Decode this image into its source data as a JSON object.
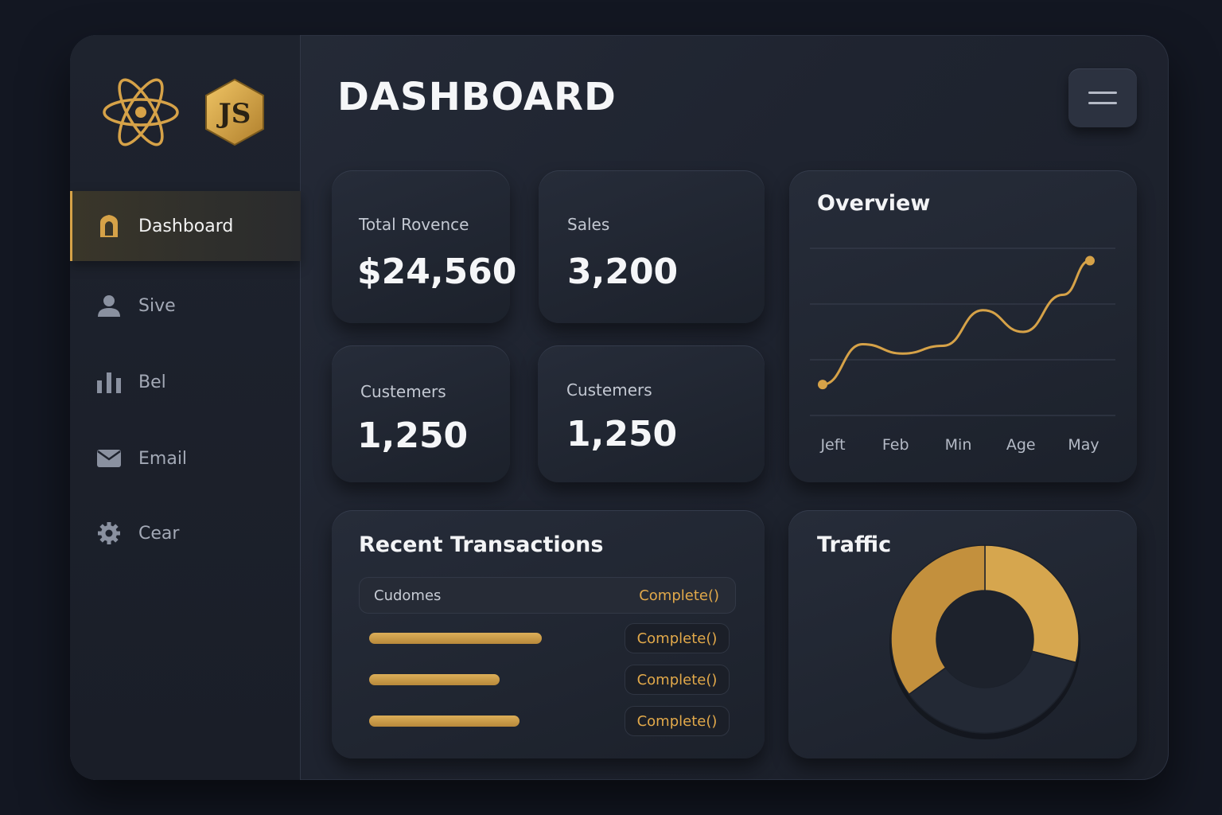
{
  "app": {
    "title": "DASHBOARD",
    "logos": [
      "react-logo",
      "js-logo"
    ],
    "js_logo_text": "JS"
  },
  "colors": {
    "accent": "#d6a248",
    "background": "#131722",
    "panel": "#1e232e",
    "text": "#e9ecf2",
    "muted": "#a3a9b6"
  },
  "sidebar": {
    "items": [
      {
        "label": "Dashboard",
        "icon": "home-icon",
        "active": true
      },
      {
        "label": "Sive",
        "icon": "user-icon",
        "active": false
      },
      {
        "label": "Bel",
        "icon": "bar-chart-icon",
        "active": false
      },
      {
        "label": "Email",
        "icon": "mail-icon",
        "active": false
      },
      {
        "label": "Cear",
        "icon": "gear-icon",
        "active": false
      }
    ]
  },
  "header": {
    "menu_icon": "hamburger-icon"
  },
  "stats": [
    {
      "label": "Total Rovence",
      "value": "$24,560"
    },
    {
      "label": "Sales",
      "value": "3,200"
    },
    {
      "label": "Custemers",
      "value": "1,250"
    },
    {
      "label": "Custemers",
      "value": "1,250"
    }
  ],
  "overview": {
    "title": "Overview",
    "chart_data": {
      "type": "line",
      "categories": [
        "Jeft",
        "Feb",
        "Min",
        "Age",
        "May"
      ],
      "x": [
        0,
        0.6,
        1.2,
        1.8,
        2.4,
        3.0,
        3.6,
        4.0
      ],
      "values": [
        2.0,
        4.6,
        4.0,
        4.5,
        6.8,
        5.4,
        7.8,
        10.0
      ],
      "ylim": [
        0,
        10.8
      ],
      "grid": true,
      "gridlines": 4,
      "color": "#d6a248"
    }
  },
  "transactions": {
    "title": "Recent Transactions",
    "header": {
      "column": "Cudomes",
      "status": "Complete()"
    },
    "rows": [
      {
        "progress": 0.86,
        "status": "Complete()"
      },
      {
        "progress": 0.65,
        "status": "Complete()"
      },
      {
        "progress": 0.75,
        "status": "Complete()"
      }
    ]
  },
  "traffic": {
    "title": "Traffic",
    "chart_data": {
      "type": "pie",
      "donut": true,
      "values": [
        29,
        36,
        35
      ],
      "colors": [
        "#d6a64e",
        "#232935",
        "#c3903d"
      ]
    }
  }
}
